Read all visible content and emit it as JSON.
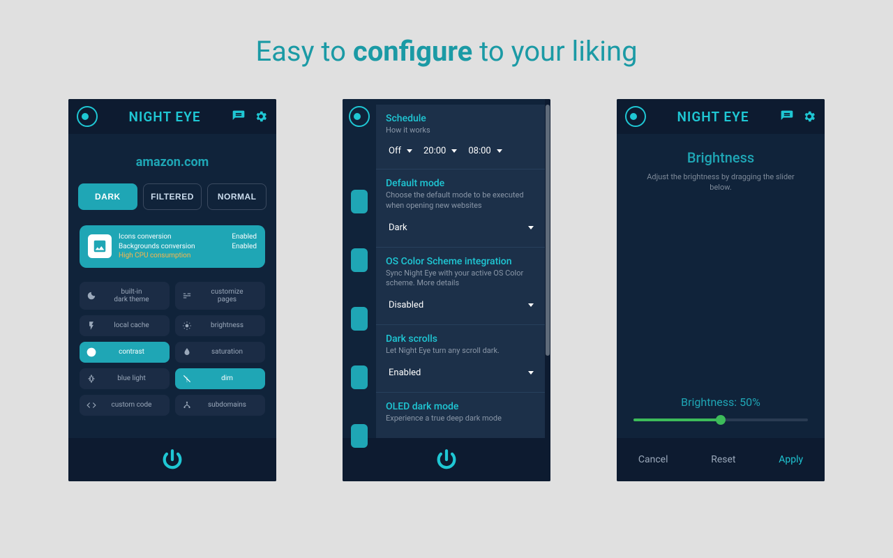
{
  "headline": {
    "pre": "Easy to ",
    "bold": "configure",
    "post": " to your liking"
  },
  "brand": "NIGHT EYE",
  "panel1": {
    "site": "amazon.com",
    "modes": [
      "DARK",
      "FILTERED",
      "NORMAL"
    ],
    "active_mode": 0,
    "conversion": {
      "icons_label": "Icons conversion",
      "icons_state": "Enabled",
      "bg_label": "Backgrounds conversion",
      "bg_state": "Enabled",
      "warn": "High CPU consumption"
    },
    "options": [
      {
        "id": "built-in-dark-theme",
        "label": "built-in\ndark theme",
        "tall": true
      },
      {
        "id": "customize-pages",
        "label": "customize\npages",
        "tall": true
      },
      {
        "id": "local-cache",
        "label": "local cache"
      },
      {
        "id": "brightness",
        "label": "brightness"
      },
      {
        "id": "contrast",
        "label": "contrast",
        "active": true
      },
      {
        "id": "saturation",
        "label": "saturation"
      },
      {
        "id": "blue-light",
        "label": "blue light"
      },
      {
        "id": "dim",
        "label": "dim",
        "active": true
      },
      {
        "id": "custom-code",
        "label": "custom code"
      },
      {
        "id": "subdomains",
        "label": "subdomains"
      }
    ]
  },
  "panel2": {
    "sections": [
      {
        "title": "Schedule",
        "sub": "How it works",
        "selects": [
          "Off",
          "20:00",
          "08:00"
        ]
      },
      {
        "title": "Default mode",
        "sub": "Choose the default mode to be executed when opening new websites",
        "value": "Dark"
      },
      {
        "title": "OS Color Scheme integration",
        "sub": "Sync Night Eye with your active OS Color scheme. More details",
        "value": "Disabled"
      },
      {
        "title": "Dark scrolls",
        "sub": "Let Night Eye turn any scroll dark.",
        "value": "Enabled"
      },
      {
        "title": "OLED dark mode",
        "sub": "Experience a true deep dark mode"
      }
    ]
  },
  "panel3": {
    "title": "Brightness",
    "sub": "Adjust the brightness by dragging the slider below.",
    "value_label": "Brightness: 50%",
    "percent": 50,
    "footer": {
      "cancel": "Cancel",
      "reset": "Reset",
      "apply": "Apply"
    }
  }
}
